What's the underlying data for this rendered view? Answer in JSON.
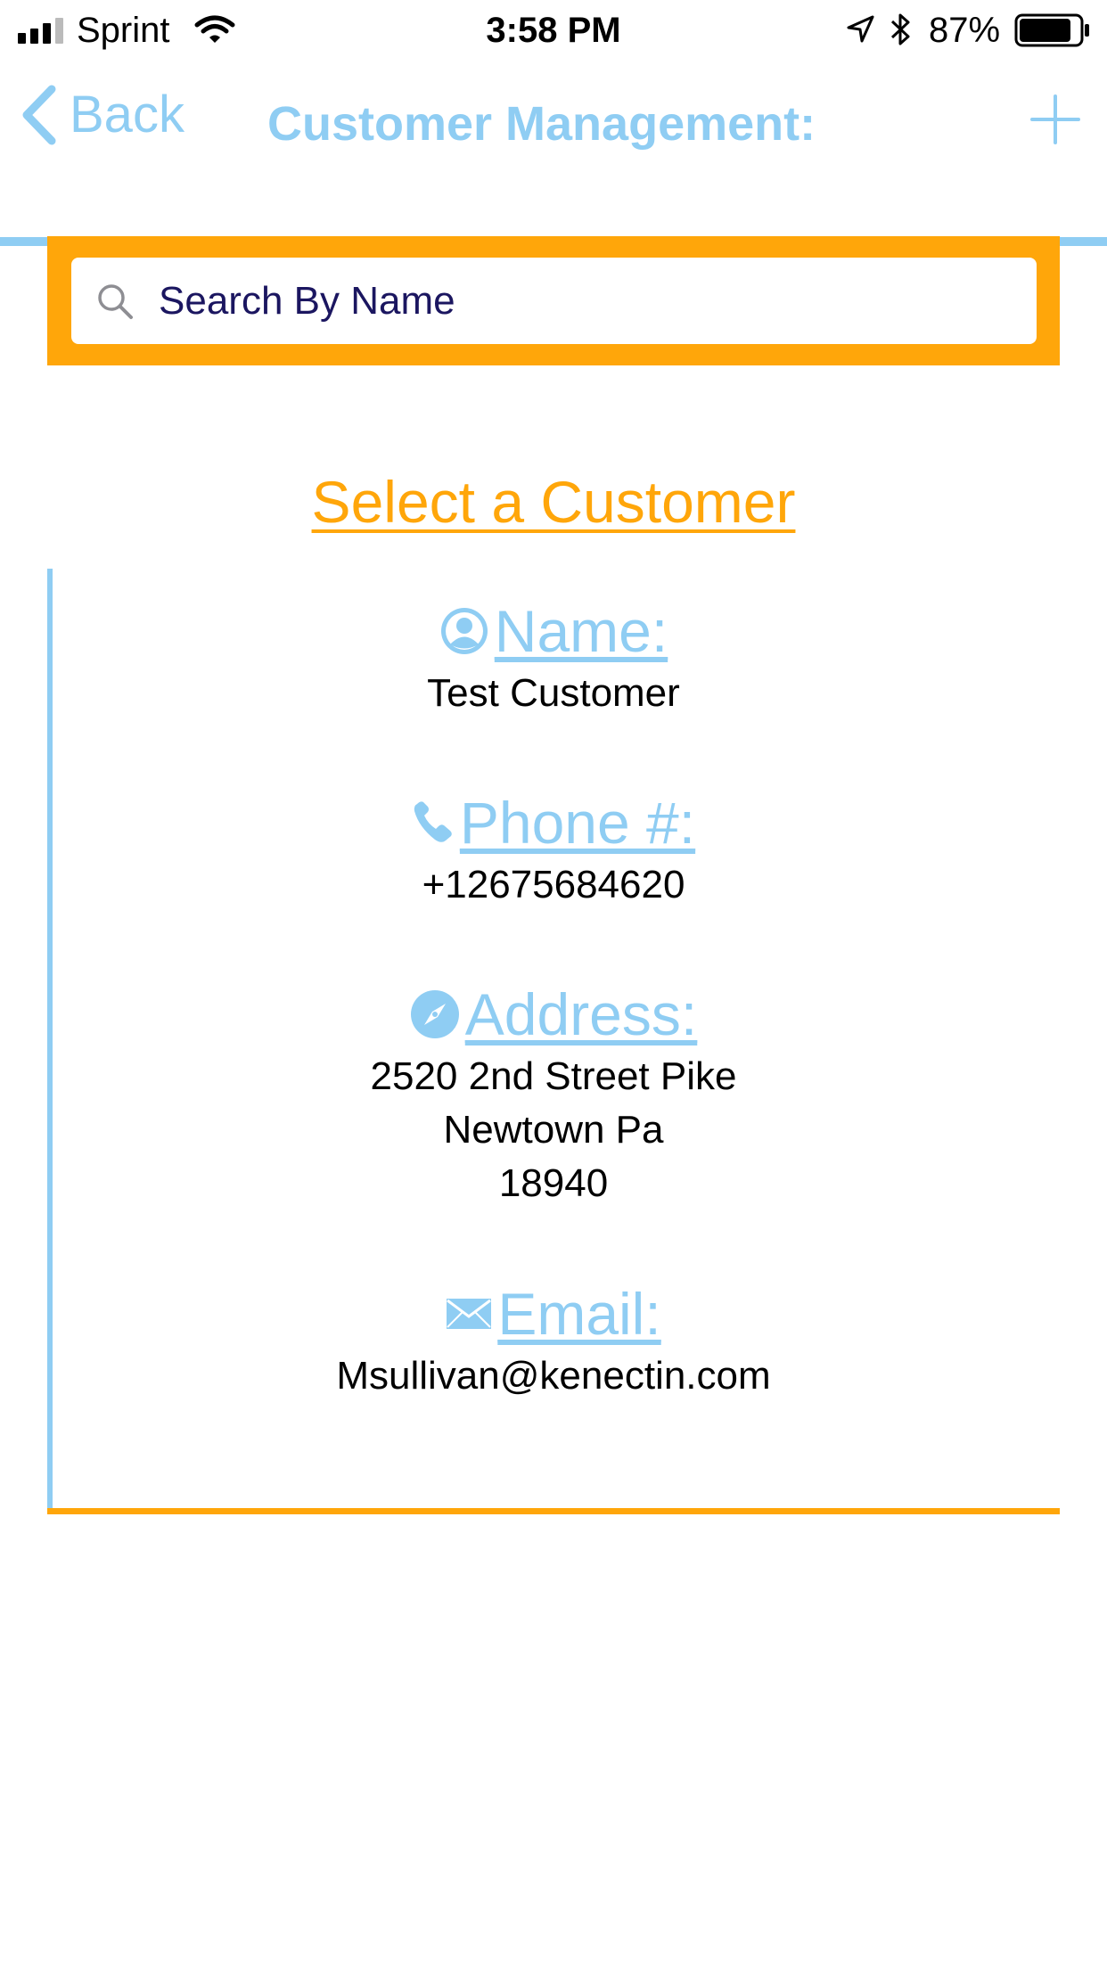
{
  "status_bar": {
    "carrier": "Sprint",
    "time": "3:58 PM",
    "battery": "87%",
    "battery_level": 0.87
  },
  "nav": {
    "back_label": "Back",
    "title": "Customer Management:",
    "add_icon": "plus-icon"
  },
  "search": {
    "placeholder": "Search By Name",
    "value": ""
  },
  "heading": "Select a Customer",
  "customer": {
    "name_label": " Name:",
    "name": "Test Customer",
    "phone_label": " Phone #:",
    "phone": "+12675684620",
    "address_label": " Address:",
    "address_line1": "2520 2nd Street Pike",
    "address_line2": "Newtown Pa",
    "address_line3": "18940",
    "email_label": " Email:",
    "email": "Msullivan@kenectin.com"
  },
  "colors": {
    "accent_blue": "#8fcdf3",
    "accent_orange": "#ffa60a",
    "search_text": "#1b1660"
  }
}
